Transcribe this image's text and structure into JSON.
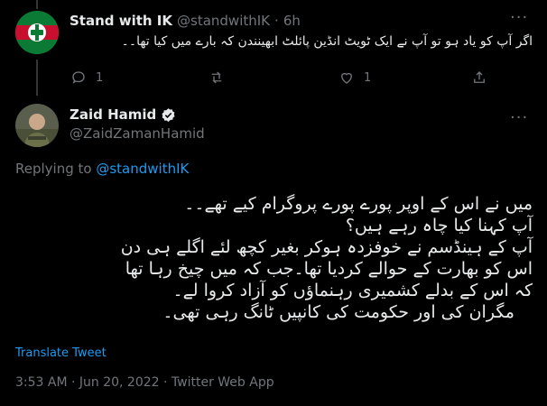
{
  "reply_tweet": {
    "display_name": "Stand with IK",
    "handle": "@standwithIK",
    "separator": "·",
    "time": "6h",
    "text": "اگر آپ کو یاد ہو تو آپ نے ایک ٹویٹ انڈین پائلٹ ابھینندن کہ بارے میں کیا تھا۔۔",
    "reply_count": "1",
    "retweet_count": "",
    "like_count": "1"
  },
  "main_tweet": {
    "display_name": "Zaid Hamid",
    "handle": "@ZaidZamanHamid",
    "replying_prefix": "Replying to",
    "replying_handle": "@standwithIK",
    "lines": [
      "میں نے اس کے اوپر پورے پورے پروگرام کیے تھے۔۔",
      "آپ کہنا کیا چاہ رہے ہیں؟",
      "آپ کے ہینڈسم نے خوفزدہ ہوکر بغیر کچھ لئے اگلے ہی دن",
      "اس کو بھارت کے حوالے کردیا تھا۔جب کہ میں چیخ رہا تھا",
      "کہ اس کے بدلے کشمیری رہنماؤں کو آزاد کروا لے۔",
      "مگران کی اور حکومت کی کانپیں ٹانگ رہی تھی۔"
    ],
    "translate_label": "Translate Tweet",
    "timestamp": "3:53 AM · Jun 20, 2022 · Twitter Web App"
  },
  "colors": {
    "background": "#000000",
    "text": "#e7e9ea",
    "muted": "#71767b",
    "accent": "#1d9bf0"
  }
}
